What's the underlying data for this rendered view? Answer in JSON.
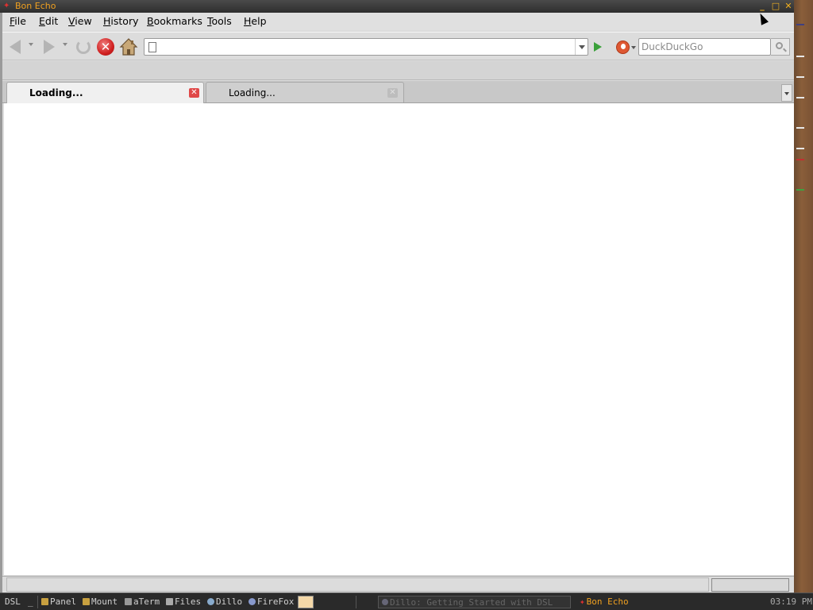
{
  "window": {
    "title": "Bon Echo",
    "controls": {
      "minimize": "_",
      "maximize": "□",
      "close": "✕"
    }
  },
  "menubar": {
    "items": [
      {
        "label": "File",
        "key": "F",
        "rest": "ile"
      },
      {
        "label": "Edit",
        "key": "E",
        "rest": "dit"
      },
      {
        "label": "View",
        "key": "V",
        "rest": "iew"
      },
      {
        "label": "History",
        "key": "H",
        "rest": "istory"
      },
      {
        "label": "Bookmarks",
        "key": "B",
        "rest": "ookmarks"
      },
      {
        "label": "Tools",
        "key": "T",
        "rest": "ools"
      },
      {
        "label": "Help",
        "key": "H",
        "rest": "elp"
      }
    ]
  },
  "toolbar": {
    "icons": [
      "back-arrow-icon",
      "forward-arrow-icon",
      "reload-icon",
      "stop-icon",
      "home-icon"
    ],
    "url": {
      "value": "",
      "placeholder": ""
    },
    "search": {
      "engine": "DuckDuckGo",
      "placeholder": "DuckDuckGo",
      "value": ""
    }
  },
  "tabs": [
    {
      "label": "Loading...",
      "active": true
    },
    {
      "label": "Loading...",
      "active": false
    }
  ],
  "status": {
    "text": "",
    "progress": 0
  },
  "taskbar": {
    "start": "DSL",
    "dash": "_",
    "launchers": [
      "Panel",
      "Mount",
      "aTerm",
      "Files",
      "Dillo",
      "FireFox"
    ],
    "tasks": [
      {
        "label": "Dillo: Getting Started with DSL",
        "active": false
      },
      {
        "label": "Bon Echo",
        "active": true
      }
    ],
    "clock": "03:19 PM"
  },
  "colors": {
    "title_text": "#f0a020",
    "stop_red": "#d02020",
    "go_green": "#3aa03a",
    "active_task": "#f0a020"
  }
}
